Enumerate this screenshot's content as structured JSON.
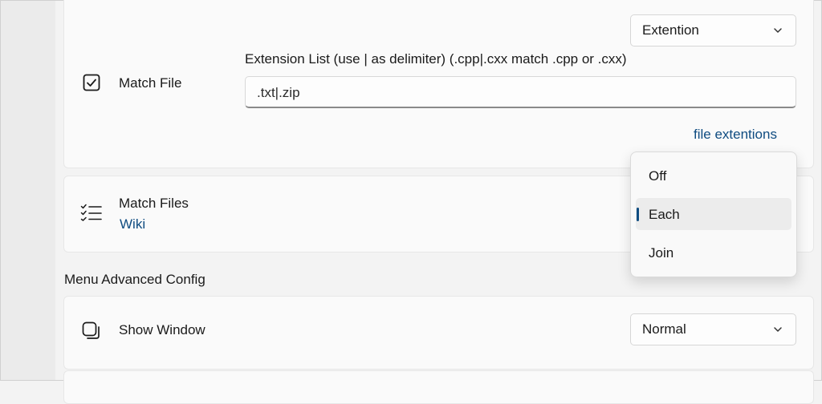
{
  "match_file": {
    "label": "Match File",
    "mode_select": "Extention",
    "list_label": "Extension List (use | as delimiter) (.cpp|.cxx match .cpp or .cxx)",
    "list_value": ".txt|.zip",
    "link": "file extentions",
    "icon": "checkbox-icon"
  },
  "match_files": {
    "label": "Match Files",
    "link": "Wiki",
    "icon": "checklist-icon"
  },
  "dropdown": {
    "options": [
      "Off",
      "Each",
      "Join"
    ],
    "selected": "Each"
  },
  "section_title": "Menu Advanced Config",
  "show_window": {
    "label": "Show Window",
    "select_value": "Normal",
    "icon": "window-stack-icon"
  },
  "colors": {
    "accent": "#0f4c81",
    "card": "#fafafa",
    "background": "#f3f3f3"
  }
}
